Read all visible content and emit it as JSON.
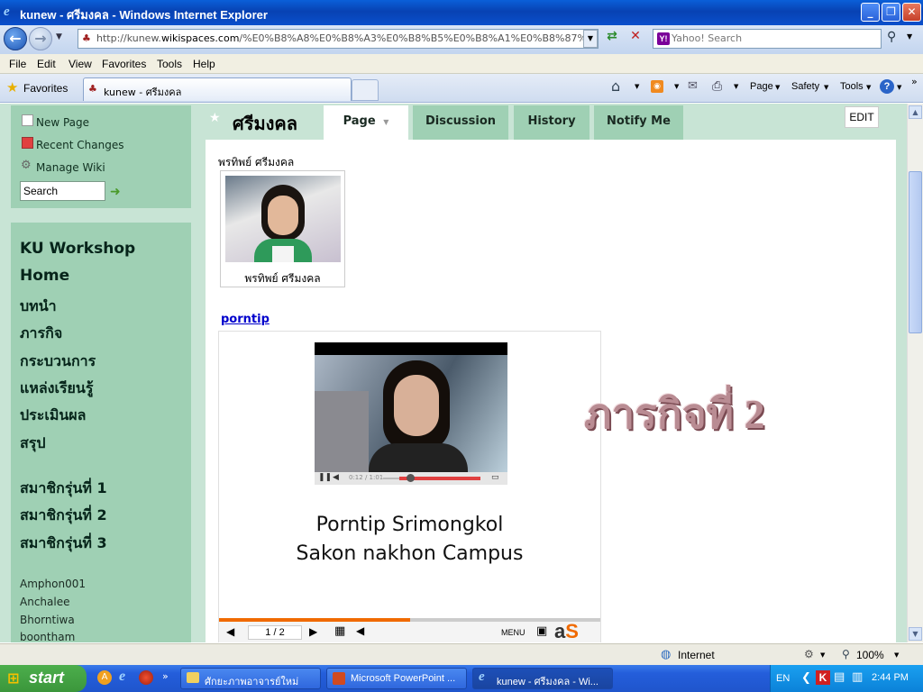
{
  "window": {
    "title": "kunew - ศรีมงคล - Windows Internet Explorer"
  },
  "address": {
    "url_prefix": "http://kunew.",
    "url_host": "wikispaces.com",
    "url_rest": "/%E0%B8%A8%E0%B8%A3%E0%B8%B5%E0%B8%A1%E0%B8%87%E0%B8",
    "search_placeholder": "Yahoo! Search"
  },
  "menu": [
    "File",
    "Edit",
    "View",
    "Favorites",
    "Tools",
    "Help"
  ],
  "favorites": {
    "label": "Favorites",
    "tab_title": "kunew - ศรีมงคล"
  },
  "commandbar": {
    "page": "Page",
    "safety": "Safety",
    "tools": "Tools"
  },
  "sidebar": {
    "links": [
      "New Page",
      "Recent Changes",
      "Manage Wiki"
    ],
    "search_value": "Search",
    "nav": [
      "KU Workshop",
      "Home",
      "บทนำ",
      "ภารกิจ",
      "กระบวนการ",
      "แหล่งเรียนรู้",
      "ประเมินผล",
      "สรุป"
    ],
    "groups": [
      "สมาชิกรุ่นที่ 1",
      "สมาชิกรุ่นที่ 2",
      "สมาชิกรุ่นที่ 3"
    ],
    "members": [
      "Amphon001",
      "Anchalee",
      "Bhorntiwa",
      "boontham"
    ]
  },
  "page": {
    "title": "ศรีมงคล",
    "tabs": [
      "Page",
      "Discussion",
      "History",
      "Notify Me"
    ],
    "edit": "EDIT",
    "photo_label": "พรทิพย์ ศรีมงคล",
    "photo_caption": "พรทิพย์ ศรีมงคล",
    "link": "porntip",
    "video_time": "0:12 / 1:01",
    "slide_line1": "Porntip  Srimongkol",
    "slide_line2": "Sakon nakhon Campus",
    "slide_page": "1 / 2",
    "slide_menu": "MENU",
    "slide_progress": 0.5,
    "mission": "ภารกิจที่ 2"
  },
  "status": {
    "zone": "Internet",
    "zoom": "100%"
  },
  "taskbar": {
    "start": "start",
    "tasks": [
      "ศักยะภาพอาจารย์ใหม่",
      "Microsoft PowerPoint ...",
      "kunew - ศรีมงคล - Wi..."
    ],
    "lang": "EN",
    "clock": "2:44 PM"
  }
}
